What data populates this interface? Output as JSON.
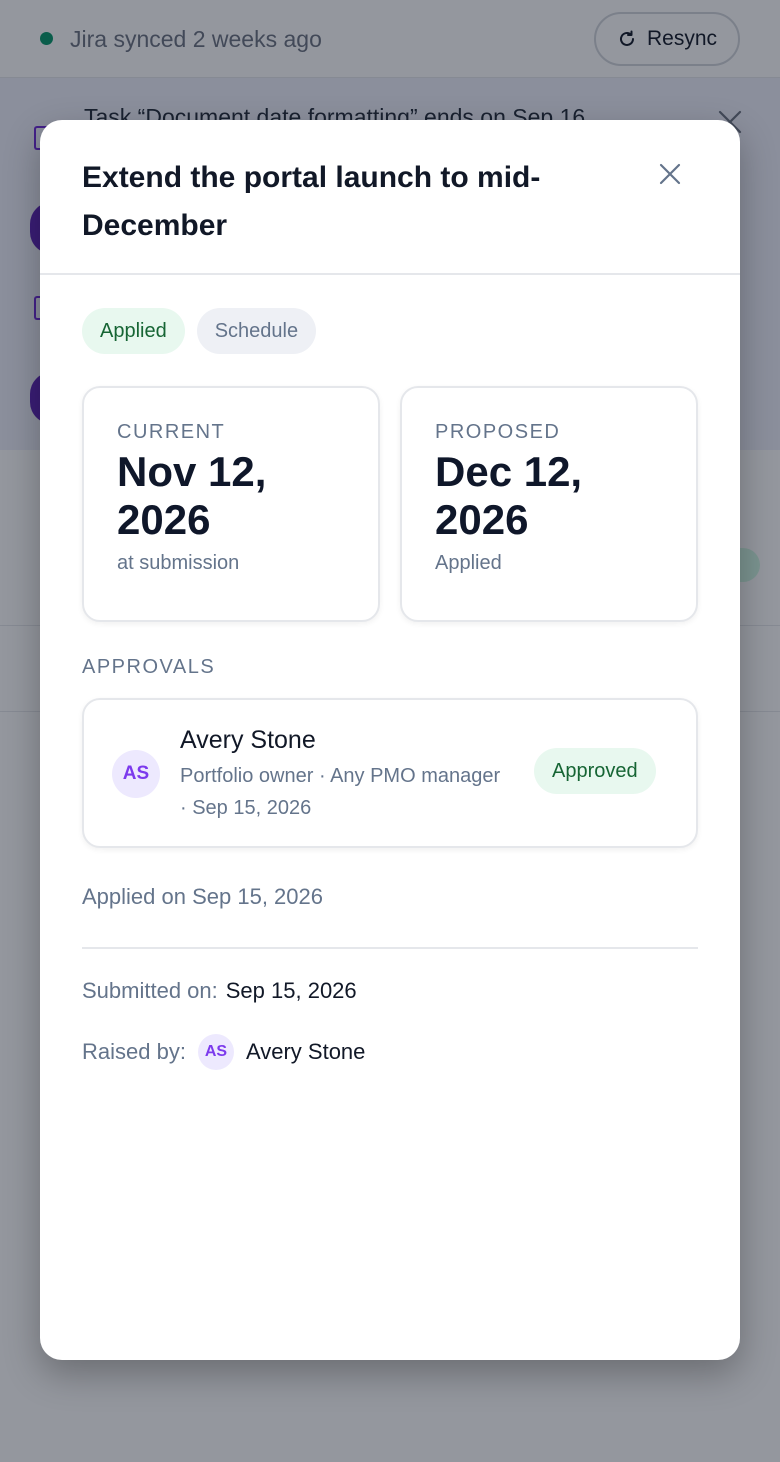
{
  "sync_bar": {
    "status_text": "Jira synced 2 weeks ago",
    "status_color": "#059669",
    "resync_label": "Resync",
    "resync_icon": "refresh-icon"
  },
  "notice": {
    "text": "Task “Document date formatting” ends on Sep 16",
    "close_icon": "close-icon"
  },
  "modal": {
    "title": "Extend the portal launch to mid-December",
    "close_icon": "close-icon",
    "chips": {
      "status": "Applied",
      "type": "Schedule"
    },
    "current": {
      "label": "CURRENT",
      "date": "Nov 12, 2026",
      "sub": "at submission"
    },
    "proposed": {
      "label": "PROPOSED",
      "date": "Dec 12, 2026",
      "sub": "Applied"
    },
    "approvals": {
      "label": "APPROVALS",
      "items": [
        {
          "initials": "AS",
          "name": "Avery Stone",
          "meta": "Portfolio owner · Any PMO manager · Sep 15, 2026",
          "status": "Approved"
        }
      ]
    },
    "applied_on": "Applied on Sep 15, 2026",
    "submitted": {
      "label": "Submitted on:",
      "value": "Sep 15, 2026"
    },
    "raised_by": {
      "label": "Raised by:",
      "initials": "AS",
      "name": "Avery Stone"
    }
  },
  "colors": {
    "accent_purple": "#7c3aed",
    "success_green": "#166534",
    "success_bg": "#e8f8ef"
  }
}
